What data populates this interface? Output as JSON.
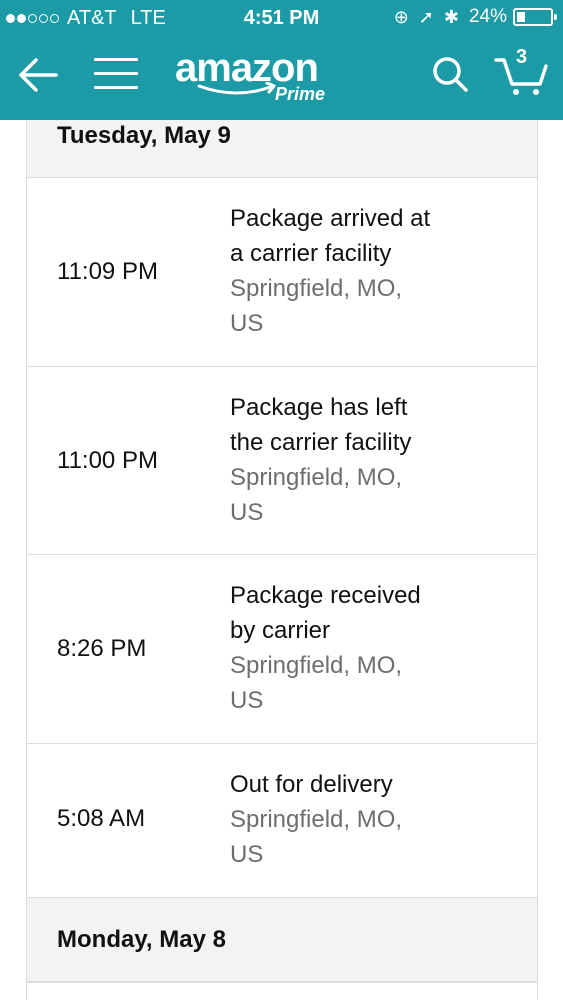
{
  "status_bar": {
    "carrier": "AT&T",
    "network": "LTE",
    "time": "4:51 PM",
    "battery": "24%",
    "battery_level": 0.24,
    "signal_bars_filled": 2,
    "signal_bars_total": 5
  },
  "nav": {
    "logo_text": "amazon",
    "logo_sub": "Prime",
    "cart_count": "3",
    "icons": [
      "back-arrow-icon",
      "hamburger-menu-icon",
      "search-icon",
      "cart-icon"
    ]
  },
  "tracking": {
    "days": [
      {
        "date": "Tuesday, May 9",
        "events": [
          {
            "time": "11:09 PM",
            "desc_line1": "Package arrived at",
            "desc_line2": "a carrier facility",
            "loc_line1": "Springfield, MO,",
            "loc_line2": "US"
          },
          {
            "time": "11:00 PM",
            "desc_line1": "Package has left",
            "desc_line2": "the carrier facility",
            "loc_line1": "Springfield, MO,",
            "loc_line2": "US"
          },
          {
            "time": "8:26 PM",
            "desc_line1": "Package received",
            "desc_line2": "by carrier",
            "loc_line1": "Springfield, MO,",
            "loc_line2": "US"
          },
          {
            "time": "5:08 AM",
            "desc_line1": "Out for delivery",
            "loc_line1": "Springfield, MO,",
            "loc_line2": "US"
          }
        ]
      },
      {
        "date": "Monday, May 8"
      }
    ]
  },
  "colors": {
    "brand_teal": "#1c9aa6",
    "header_bg": "#f3f3f3",
    "location_gray": "#6e6e6e"
  }
}
